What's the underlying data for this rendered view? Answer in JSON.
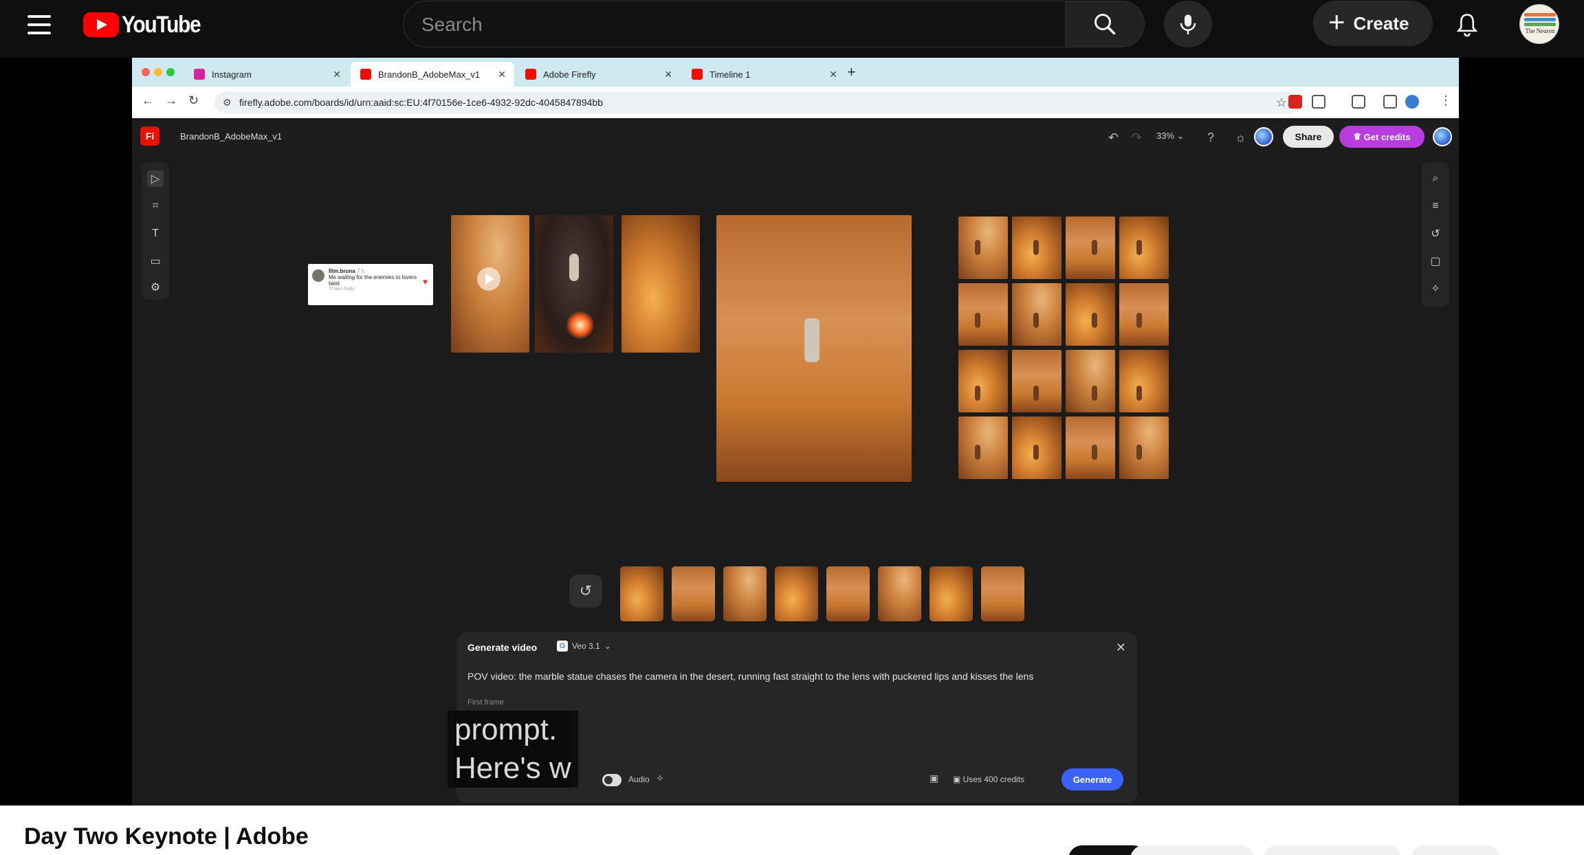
{
  "youtube": {
    "logo_text": "YouTube",
    "search_placeholder": "Search",
    "create_label": "Create",
    "avatar_text": "The Neuron"
  },
  "browser": {
    "tabs": [
      {
        "label": "Instagram",
        "active": false,
        "favicon_color": "#d6249f"
      },
      {
        "label": "BrandonB_AdobeMax_v1",
        "active": true,
        "favicon_color": "#eb1000"
      },
      {
        "label": "Adobe Firefly",
        "active": false,
        "favicon_color": "#eb1000"
      },
      {
        "label": "Timeline 1",
        "active": false,
        "favicon_color": "#eb1000"
      }
    ],
    "url": "firefly.adobe.com/boards/id/urn:aaid:sc:EU:4f70156e-1ce6-4932-92dc-4045847894bb"
  },
  "firefly": {
    "logo": "Fi",
    "board_title": "BrandonB_AdobeMax_v1",
    "zoom": "33%",
    "share_label": "Share",
    "credits_label": "Get credits",
    "comment": {
      "user": "film.bruna",
      "time": "7 h",
      "text": "Me waiting for the enemies to lovers twist",
      "meta": "72 likes   Reply"
    },
    "generate": {
      "title": "Generate video",
      "model": "Veo 3.1",
      "prompt": "POV video: the marble statue chases the camera in the desert, running fast straight to the lens with puckered lips and kisses the lens",
      "first_frame_label": "First frame",
      "audio_label": "Audio",
      "credits_text": "Uses 400 credits",
      "generate_label": "Generate"
    }
  },
  "captions": {
    "line1": "prompt.",
    "line2": "Here's w"
  },
  "video": {
    "title": "Day Two Keynote | Adobe"
  },
  "colors": {
    "youtube_red": "#ff0000",
    "firefly_red": "#eb1000",
    "credits_purple": "#b83ce0",
    "generate_blue": "#3b63fb",
    "tab_bar": "#cfe9f1"
  }
}
